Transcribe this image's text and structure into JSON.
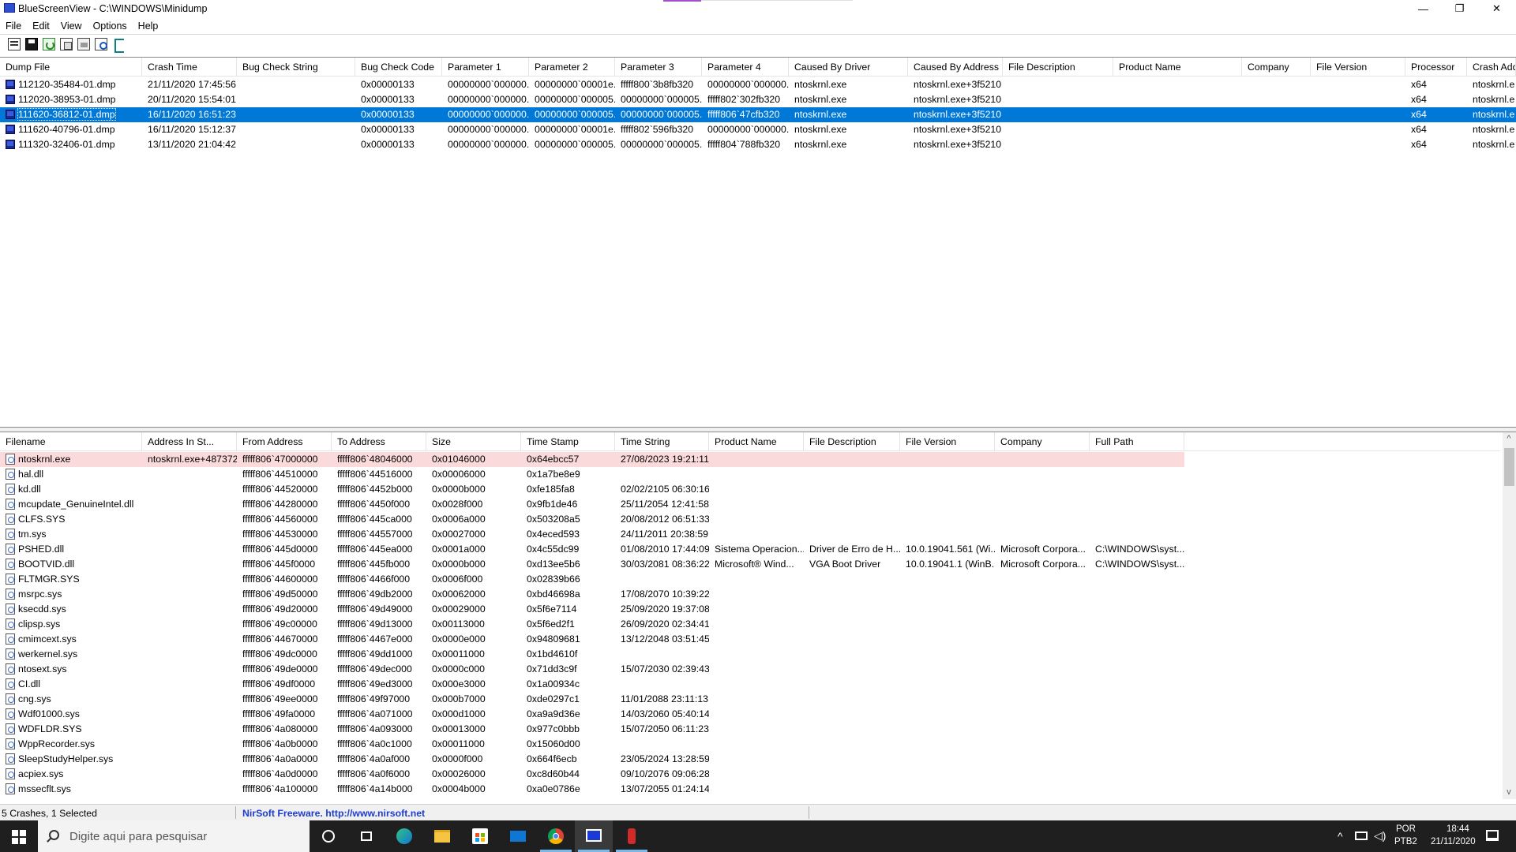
{
  "window": {
    "title": "BlueScreenView - C:\\WINDOWS\\Minidump",
    "minimize": "—",
    "maximize": "❐",
    "close": "✕"
  },
  "menu": [
    "File",
    "Edit",
    "View",
    "Options",
    "Help"
  ],
  "toolbar_icons": [
    "html-report-icon",
    "save-icon",
    "refresh-icon",
    "copy-icon",
    "properties-icon",
    "find-icon",
    "exit-icon"
  ],
  "upper": {
    "columns": [
      "Dump File",
      "Crash Time",
      "Bug Check String",
      "Bug Check Code",
      "Parameter 1",
      "Parameter 2",
      "Parameter 3",
      "Parameter 4",
      "Caused By Driver",
      "Caused By Address",
      "File Description",
      "Product Name",
      "Company",
      "File Version",
      "Processor",
      "Crash Add"
    ],
    "rows": [
      [
        "112120-35484-01.dmp",
        "21/11/2020 17:45:56",
        "",
        "0x00000133",
        "00000000`000000...",
        "00000000`00001e...",
        "fffff800`3b8fb320",
        "00000000`000000...",
        "ntoskrnl.exe",
        "ntoskrnl.exe+3f5210",
        "",
        "",
        "",
        "",
        "x64",
        "ntoskrnl.e"
      ],
      [
        "112020-38953-01.dmp",
        "20/11/2020 15:54:01",
        "",
        "0x00000133",
        "00000000`000000...",
        "00000000`000005...",
        "00000000`000005...",
        "fffff802`302fb320",
        "ntoskrnl.exe",
        "ntoskrnl.exe+3f5210",
        "",
        "",
        "",
        "",
        "x64",
        "ntoskrnl.e"
      ],
      [
        "111620-36812-01.dmp",
        "16/11/2020 16:51:23",
        "",
        "0x00000133",
        "00000000`000000...",
        "00000000`000005...",
        "00000000`000005...",
        "fffff806`47cfb320",
        "ntoskrnl.exe",
        "ntoskrnl.exe+3f5210",
        "",
        "",
        "",
        "",
        "x64",
        "ntoskrnl.e"
      ],
      [
        "111620-40796-01.dmp",
        "16/11/2020 15:12:37",
        "",
        "0x00000133",
        "00000000`000000...",
        "00000000`00001e...",
        "fffff802`596fb320",
        "00000000`000000...",
        "ntoskrnl.exe",
        "ntoskrnl.exe+3f5210",
        "",
        "",
        "",
        "",
        "x64",
        "ntoskrnl.e"
      ],
      [
        "111320-32406-01.dmp",
        "13/11/2020 21:04:42",
        "",
        "0x00000133",
        "00000000`000000...",
        "00000000`000005...",
        "00000000`000005...",
        "fffff804`788fb320",
        "ntoskrnl.exe",
        "ntoskrnl.exe+3f5210",
        "",
        "",
        "",
        "",
        "x64",
        "ntoskrnl.e"
      ]
    ],
    "selected_index": 2
  },
  "lower": {
    "columns": [
      "Filename",
      "Address In St...",
      "From Address",
      "To Address",
      "Size",
      "Time Stamp",
      "Time String",
      "Product Name",
      "File Description",
      "File Version",
      "Company",
      "Full Path"
    ],
    "rows": [
      [
        "ntoskrnl.exe",
        "ntoskrnl.exe+487372",
        "fffff806`47000000",
        "fffff806`48046000",
        "0x01046000",
        "0x64ebcc57",
        "27/08/2023 19:21:11",
        "",
        "",
        "",
        "",
        ""
      ],
      [
        "hal.dll",
        "",
        "fffff806`44510000",
        "fffff806`44516000",
        "0x00006000",
        "0x1a7be8e9",
        "",
        "",
        "",
        "",
        "",
        ""
      ],
      [
        "kd.dll",
        "",
        "fffff806`44520000",
        "fffff806`4452b000",
        "0x0000b000",
        "0xfe185fa8",
        "02/02/2105 06:30:16",
        "",
        "",
        "",
        "",
        ""
      ],
      [
        "mcupdate_GenuineIntel.dll",
        "",
        "fffff806`44280000",
        "fffff806`4450f000",
        "0x0028f000",
        "0x9fb1de46",
        "25/11/2054 12:41:58",
        "",
        "",
        "",
        "",
        ""
      ],
      [
        "CLFS.SYS",
        "",
        "fffff806`44560000",
        "fffff806`445ca000",
        "0x0006a000",
        "0x503208a5",
        "20/08/2012 06:51:33",
        "",
        "",
        "",
        "",
        ""
      ],
      [
        "tm.sys",
        "",
        "fffff806`44530000",
        "fffff806`44557000",
        "0x00027000",
        "0x4eced593",
        "24/11/2011 20:38:59",
        "",
        "",
        "",
        "",
        ""
      ],
      [
        "PSHED.dll",
        "",
        "fffff806`445d0000",
        "fffff806`445ea000",
        "0x0001a000",
        "0x4c55dc99",
        "01/08/2010 17:44:09",
        "Sistema Operacion...",
        "Driver de Erro de H...",
        "10.0.19041.561 (Wi...",
        "Microsoft Corpora...",
        "C:\\WINDOWS\\syst..."
      ],
      [
        "BOOTVID.dll",
        "",
        "fffff806`445f0000",
        "fffff806`445fb000",
        "0x0000b000",
        "0xd13ee5b6",
        "30/03/2081 08:36:22",
        "Microsoft® Wind...",
        "VGA Boot Driver",
        "10.0.19041.1 (WinB...",
        "Microsoft Corpora...",
        "C:\\WINDOWS\\syst..."
      ],
      [
        "FLTMGR.SYS",
        "",
        "fffff806`44600000",
        "fffff806`4466f000",
        "0x0006f000",
        "0x02839b66",
        "",
        "",
        "",
        "",
        "",
        ""
      ],
      [
        "msrpc.sys",
        "",
        "fffff806`49d50000",
        "fffff806`49db2000",
        "0x00062000",
        "0xbd46698a",
        "17/08/2070 10:39:22",
        "",
        "",
        "",
        "",
        ""
      ],
      [
        "ksecdd.sys",
        "",
        "fffff806`49d20000",
        "fffff806`49d49000",
        "0x00029000",
        "0x5f6e7114",
        "25/09/2020 19:37:08",
        "",
        "",
        "",
        "",
        ""
      ],
      [
        "clipsp.sys",
        "",
        "fffff806`49c00000",
        "fffff806`49d13000",
        "0x00113000",
        "0x5f6ed2f1",
        "26/09/2020 02:34:41",
        "",
        "",
        "",
        "",
        ""
      ],
      [
        "cmimcext.sys",
        "",
        "fffff806`44670000",
        "fffff806`4467e000",
        "0x0000e000",
        "0x94809681",
        "13/12/2048 03:51:45",
        "",
        "",
        "",
        "",
        ""
      ],
      [
        "werkernel.sys",
        "",
        "fffff806`49dc0000",
        "fffff806`49dd1000",
        "0x00011000",
        "0x1bd4610f",
        "",
        "",
        "",
        "",
        "",
        ""
      ],
      [
        "ntosext.sys",
        "",
        "fffff806`49de0000",
        "fffff806`49dec000",
        "0x0000c000",
        "0x71dd3c9f",
        "15/07/2030 02:39:43",
        "",
        "",
        "",
        "",
        ""
      ],
      [
        "CI.dll",
        "",
        "fffff806`49df0000",
        "fffff806`49ed3000",
        "0x000e3000",
        "0x1a00934c",
        "",
        "",
        "",
        "",
        "",
        ""
      ],
      [
        "cng.sys",
        "",
        "fffff806`49ee0000",
        "fffff806`49f97000",
        "0x000b7000",
        "0xde0297c1",
        "11/01/2088 23:11:13",
        "",
        "",
        "",
        "",
        ""
      ],
      [
        "Wdf01000.sys",
        "",
        "fffff806`49fa0000",
        "fffff806`4a071000",
        "0x000d1000",
        "0xa9a9d36e",
        "14/03/2060 05:40:14",
        "",
        "",
        "",
        "",
        ""
      ],
      [
        "WDFLDR.SYS",
        "",
        "fffff806`4a080000",
        "fffff806`4a093000",
        "0x00013000",
        "0x977c0bbb",
        "15/07/2050 06:11:23",
        "",
        "",
        "",
        "",
        ""
      ],
      [
        "WppRecorder.sys",
        "",
        "fffff806`4a0b0000",
        "fffff806`4a0c1000",
        "0x00011000",
        "0x15060d00",
        "",
        "",
        "",
        "",
        "",
        ""
      ],
      [
        "SleepStudyHelper.sys",
        "",
        "fffff806`4a0a0000",
        "fffff806`4a0af000",
        "0x0000f000",
        "0x664f6ecb",
        "23/05/2024 13:28:59",
        "",
        "",
        "",
        "",
        ""
      ],
      [
        "acpiex.sys",
        "",
        "fffff806`4a0d0000",
        "fffff806`4a0f6000",
        "0x00026000",
        "0xc8d60b44",
        "09/10/2076 09:06:28",
        "",
        "",
        "",
        "",
        ""
      ],
      [
        "mssecflt.sys",
        "",
        "fffff806`4a100000",
        "fffff806`4a14b000",
        "0x0004b000",
        "0xa0e0786e",
        "13/07/2055 01:24:14",
        "",
        "",
        "",
        "",
        ""
      ]
    ],
    "highlighted_index": 0
  },
  "status": {
    "count": "5 Crashes, 1 Selected",
    "credit": "NirSoft Freeware.  http://www.nirsoft.net"
  },
  "taskbar": {
    "search_placeholder": "Digite aqui para pesquisar",
    "lang1": "POR",
    "lang2": "PTB2",
    "time": "18:44",
    "date": "21/11/2020"
  }
}
